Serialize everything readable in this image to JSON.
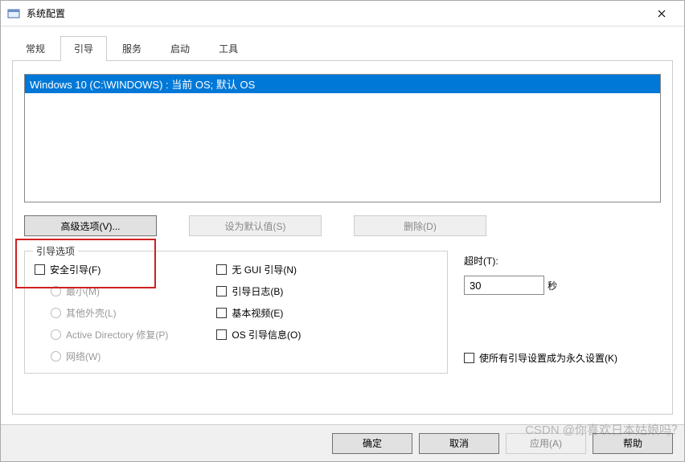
{
  "window": {
    "title": "系统配置"
  },
  "tabs": {
    "general": "常规",
    "boot": "引导",
    "services": "服务",
    "startup": "启动",
    "tools": "工具"
  },
  "bootlist": {
    "item0": "Windows 10 (C:\\WINDOWS) : 当前 OS; 默认 OS"
  },
  "buttons": {
    "advanced": "高级选项(V)...",
    "setdefault": "设为默认值(S)",
    "delete": "删除(D)"
  },
  "bootoptions": {
    "legend": "引导选项",
    "safeboot": "安全引导(F)",
    "minimal": "最小(M)",
    "altshell": "其他外壳(L)",
    "adrepair": "Active Directory 修复(P)",
    "network": "网络(W)",
    "nogui": "无 GUI 引导(N)",
    "bootlog": "引导日志(B)",
    "basevideo": "基本视频(E)",
    "osbootinfo": "OS 引导信息(O)"
  },
  "timeout": {
    "label": "超时(T):",
    "value": "30",
    "suffix": "秒"
  },
  "permanent": "使所有引导设置成为永久设置(K)",
  "footer": {
    "ok": "确定",
    "cancel": "取消",
    "apply": "应用(A)",
    "help": "帮助"
  },
  "watermark": "CSDN @你喜欢日本姑娘吗？"
}
